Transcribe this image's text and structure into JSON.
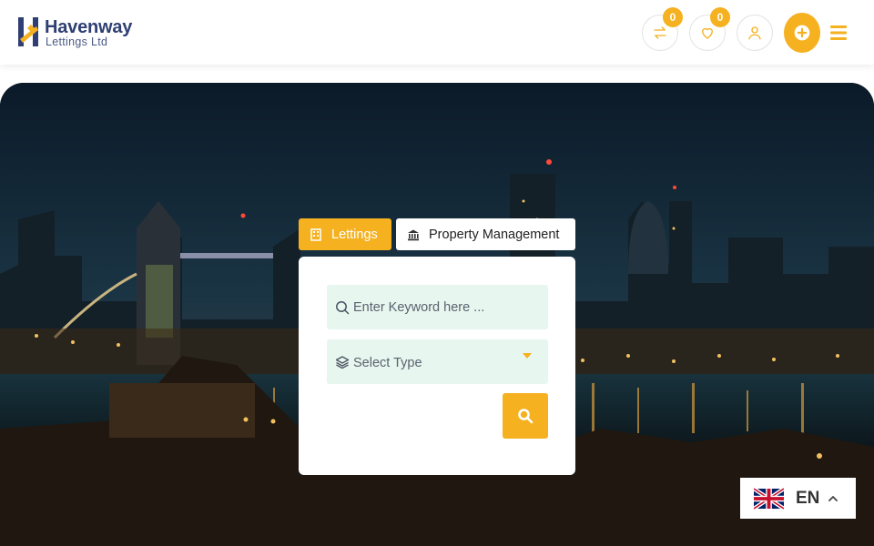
{
  "brand": {
    "name": "Havenway",
    "tagline": "Lettings Ltd"
  },
  "header": {
    "compare_count": "0",
    "wishlist_count": "0",
    "icons": [
      "compare-arrows-icon",
      "heart-icon",
      "user-icon",
      "plus-circle-icon",
      "hamburger-menu-icon"
    ]
  },
  "search": {
    "tabs": [
      {
        "label": "Lettings",
        "icon": "building-icon",
        "active": true
      },
      {
        "label": "Property Management",
        "icon": "bank-icon",
        "active": false
      }
    ],
    "keyword_placeholder": "Enter Keyword here ...",
    "type_select_label": "Select Type"
  },
  "language": {
    "code": "EN",
    "flag": "uk-flag-icon"
  },
  "colors": {
    "accent": "#f5b120",
    "brand_navy": "#2f3f73",
    "field_bg": "#e7f6ee"
  }
}
